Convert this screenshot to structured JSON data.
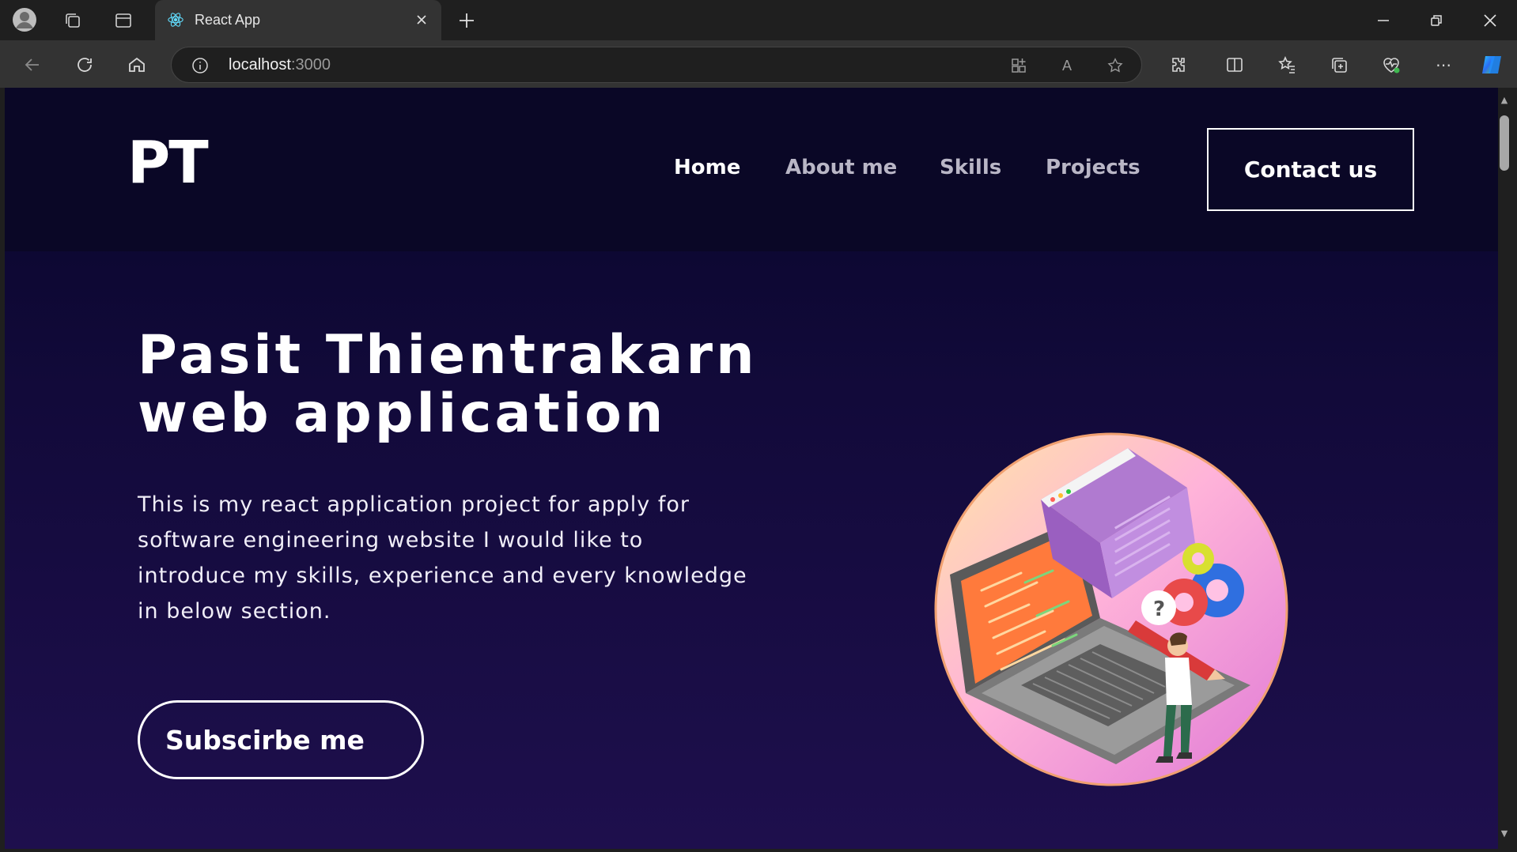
{
  "browser": {
    "tab_title": "React App",
    "url_host": "localhost",
    "url_port": ":3000",
    "icons": [
      "profile-icon",
      "workspaces-icon",
      "tab-actions-icon",
      "react-favicon",
      "close-icon",
      "new-tab-icon",
      "minimize-icon",
      "restore-icon",
      "window-close-icon",
      "back-icon",
      "refresh-icon",
      "home-icon",
      "info-icon",
      "apps-icon",
      "read-aloud-icon",
      "favorite-star-icon",
      "extensions-icon",
      "split-screen-icon",
      "favorites-icon",
      "collections-icon",
      "browser-essentials-icon",
      "more-icon",
      "copilot-icon"
    ]
  },
  "nav": {
    "logo": "PT",
    "links": [
      "Home",
      "About me",
      "Skills",
      "Projects"
    ],
    "active": "Home",
    "contact_label": "Contact us"
  },
  "hero": {
    "title_line1": "Pasit Thientrakarn",
    "title_line2": "web application",
    "description": "This is my react application project for apply for software engineering website I would like to introduce my skills, experience and every knowledge in below section.",
    "subscribe_label": "Subscirbe me"
  },
  "colors": {
    "nav_bg": "#0a0726",
    "hero_bg_top": "#120a3a",
    "hero_bg_bottom": "#1e0f4d",
    "text": "#ffffff",
    "nav_inactive": "#b9b6c6"
  }
}
